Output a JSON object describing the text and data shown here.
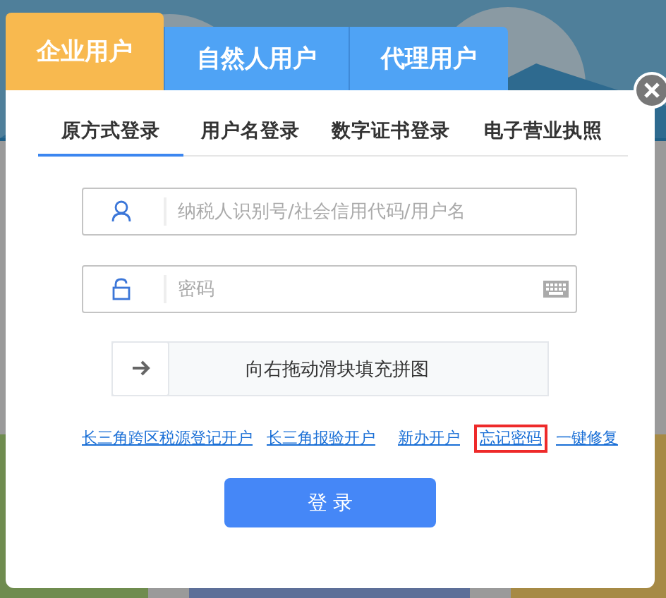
{
  "user_tabs": [
    {
      "label": "企业用户",
      "selected": true
    },
    {
      "label": "自然人用户",
      "selected": false
    },
    {
      "label": "代理用户",
      "selected": false
    }
  ],
  "login_tabs": [
    {
      "label": "原方式登录",
      "selected": true
    },
    {
      "label": "用户名登录",
      "selected": false
    },
    {
      "label": "数字证书登录",
      "selected": false
    },
    {
      "label": "电子营业执照",
      "selected": false
    }
  ],
  "account_field": {
    "placeholder": "纳税人识别号/社会信用代码/用户名"
  },
  "password_field": {
    "placeholder": "密码"
  },
  "slider_captcha": {
    "label": "向右拖动滑块填充拼图"
  },
  "links": [
    {
      "label": "长三角跨区税源登记开户",
      "highlighted": false
    },
    {
      "label": "长三角报验开户",
      "highlighted": false
    },
    {
      "label": "新办开户",
      "highlighted": false
    },
    {
      "label": "忘记密码",
      "highlighted": true
    },
    {
      "label": "一键修复",
      "highlighted": false
    }
  ],
  "login_button": "登 录"
}
